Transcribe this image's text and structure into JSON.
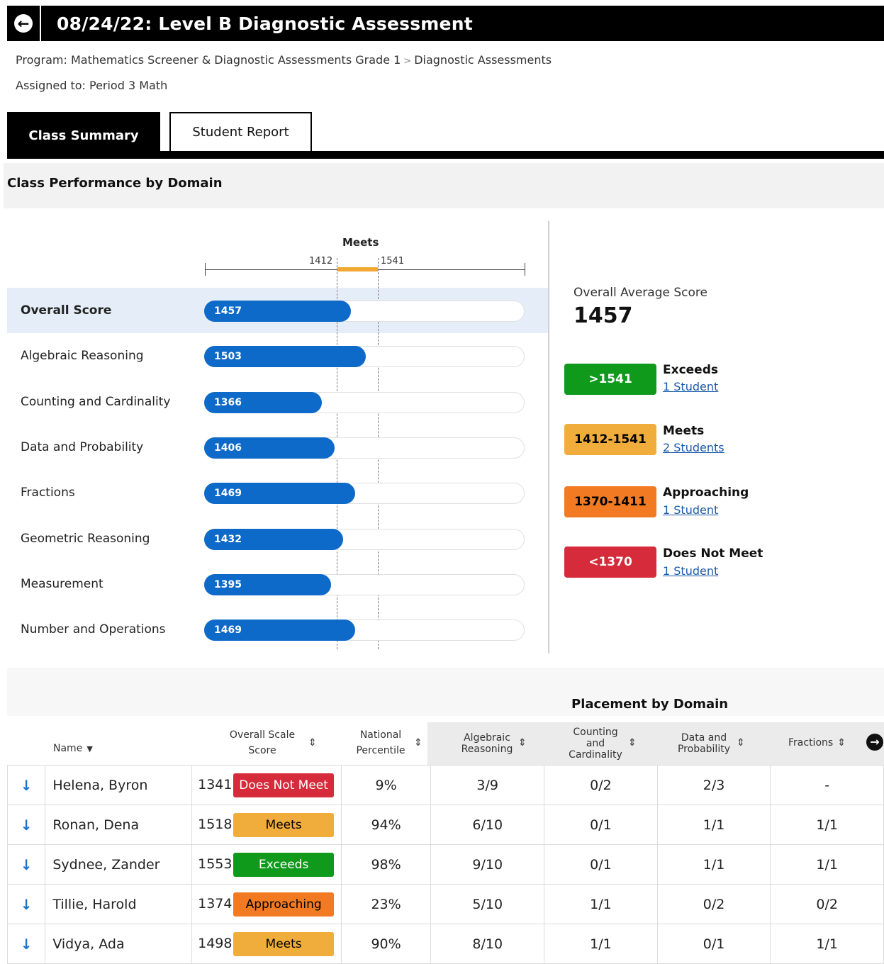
{
  "header": {
    "title": "08/24/22: Level B Diagnostic Assessment",
    "back_icon": "arrow-left-circle-icon"
  },
  "breadcrumb": {
    "program": "Program: Mathematics Screener & Diagnostic Assessments Grade 1",
    "separator": ">",
    "current": "Diagnostic Assessments"
  },
  "assigned": "Assigned to: Period 3 Math",
  "tabs": [
    {
      "label": "Class Summary",
      "active": true
    },
    {
      "label": "Student Report",
      "active": false
    }
  ],
  "section_title": "Class Performance by Domain",
  "chart": {
    "band_label": "Meets",
    "band_low": "1412",
    "band_high": "1541",
    "domains": [
      {
        "label": "Overall Score",
        "value": "1457",
        "score": 1457
      },
      {
        "label": "Algebraic Reasoning",
        "value": "1503",
        "score": 1503
      },
      {
        "label": "Counting and Cardinality",
        "value": "1366",
        "score": 1366
      },
      {
        "label": "Data and Probability",
        "value": "1406",
        "score": 1406
      },
      {
        "label": "Fractions",
        "value": "1469",
        "score": 1469
      },
      {
        "label": "Geometric Reasoning",
        "value": "1432",
        "score": 1432
      },
      {
        "label": "Measurement",
        "value": "1395",
        "score": 1395
      },
      {
        "label": "Number and Operations",
        "value": "1469",
        "score": 1469
      }
    ]
  },
  "summary": {
    "avg_label": "Overall Average Score",
    "avg_value": "1457"
  },
  "legend": [
    {
      "range": ">1541",
      "name": "Exceeds",
      "count": "1 Student",
      "color": "#0f9a1c"
    },
    {
      "range": "1412-1541",
      "name": "Meets",
      "count": "2 Students",
      "color": "#f0ad3c"
    },
    {
      "range": "1370-1411",
      "name": "Approaching",
      "count": "1 Student",
      "color": "#f27a22"
    },
    {
      "range": "<1370",
      "name": "Does Not Meet",
      "count": "1 Student",
      "color": "#d52b3a"
    }
  ],
  "table": {
    "group_title": "Placement by Domain",
    "headers": {
      "name": "Name",
      "overall_1": "Overall Scale",
      "overall_2": "Score",
      "percentile_1": "National",
      "percentile_2": "Percentile",
      "algebraic_1": "Algebraic",
      "algebraic_2": "Reasoning",
      "counting_1": "Counting",
      "counting_2": "and",
      "counting_3": "Cardinality",
      "data_1": "Data and",
      "data_2": "Probability",
      "fractions": "Fractions"
    },
    "rows": [
      {
        "name": "Helena, Byron",
        "score": "1341",
        "status": "Does Not Meet",
        "status_color": "#d52b3a",
        "status_text": "#ffffff",
        "percentile": "9%",
        "algebraic": "3/9",
        "counting": "0/2",
        "data": "2/3",
        "fractions": "-"
      },
      {
        "name": "Ronan, Dena",
        "score": "1518",
        "status": "Meets",
        "status_color": "#f0ad3c",
        "status_text": "#000000",
        "percentile": "94%",
        "algebraic": "6/10",
        "counting": "0/1",
        "data": "1/1",
        "fractions": "1/1"
      },
      {
        "name": "Sydnee, Zander",
        "score": "1553",
        "status": "Exceeds",
        "status_color": "#0f9a1c",
        "status_text": "#ffffff",
        "percentile": "98%",
        "algebraic": "9/10",
        "counting": "0/1",
        "data": "1/1",
        "fractions": "1/1"
      },
      {
        "name": "Tillie, Harold",
        "score": "1374",
        "status": "Approaching",
        "status_color": "#f27a22",
        "status_text": "#000000",
        "percentile": "23%",
        "algebraic": "5/10",
        "counting": "1/1",
        "data": "0/2",
        "fractions": "0/2"
      },
      {
        "name": "Vidya, Ada",
        "score": "1498",
        "status": "Meets",
        "status_color": "#f0ad3c",
        "status_text": "#000000",
        "percentile": "90%",
        "algebraic": "8/10",
        "counting": "1/1",
        "data": "0/1",
        "fractions": "1/1"
      }
    ]
  }
}
